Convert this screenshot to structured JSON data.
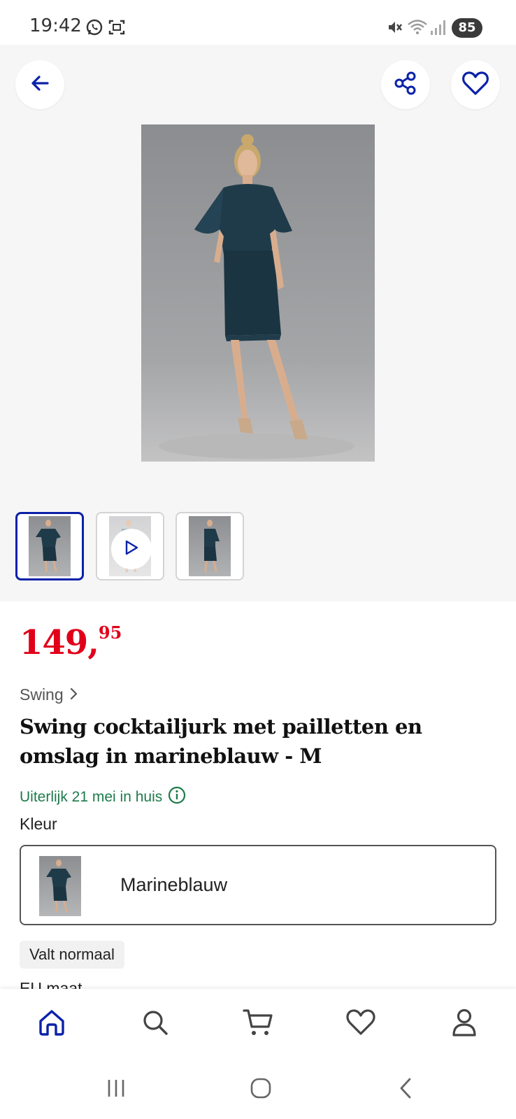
{
  "status_bar": {
    "time": "19:42",
    "battery": "85",
    "icons": [
      "whatsapp-icon",
      "screenshot-icon",
      "mute-icon",
      "wifi-icon",
      "signal-icon"
    ]
  },
  "header": {
    "back_icon": "arrow-left-icon",
    "share_icon": "share-icon",
    "wishlist_icon": "heart-icon"
  },
  "gallery": {
    "thumbnails": [
      {
        "type": "image",
        "selected": true
      },
      {
        "type": "video",
        "selected": false,
        "icon": "play-icon"
      },
      {
        "type": "image",
        "selected": false
      }
    ]
  },
  "product": {
    "price_main": "149,",
    "price_cents": "95",
    "brand": "Swing",
    "title": "Swing cocktailjurk met pailletten en omslag in marineblauw - M",
    "delivery": "Uiterlijk 21 mei in huis",
    "colour_label": "Kleur",
    "colour_value": "Marineblauw",
    "fit_badge": "Valt normaal",
    "size_label": "EU maat"
  },
  "bottom_nav": {
    "items": [
      "home-icon",
      "search-icon",
      "cart-icon",
      "heart-icon",
      "account-icon"
    ],
    "active": "home-icon"
  },
  "colors": {
    "accent": "#0a21a8",
    "price": "#e1001a",
    "delivery": "#1e7b4a",
    "dress": "#1f3b4a"
  }
}
